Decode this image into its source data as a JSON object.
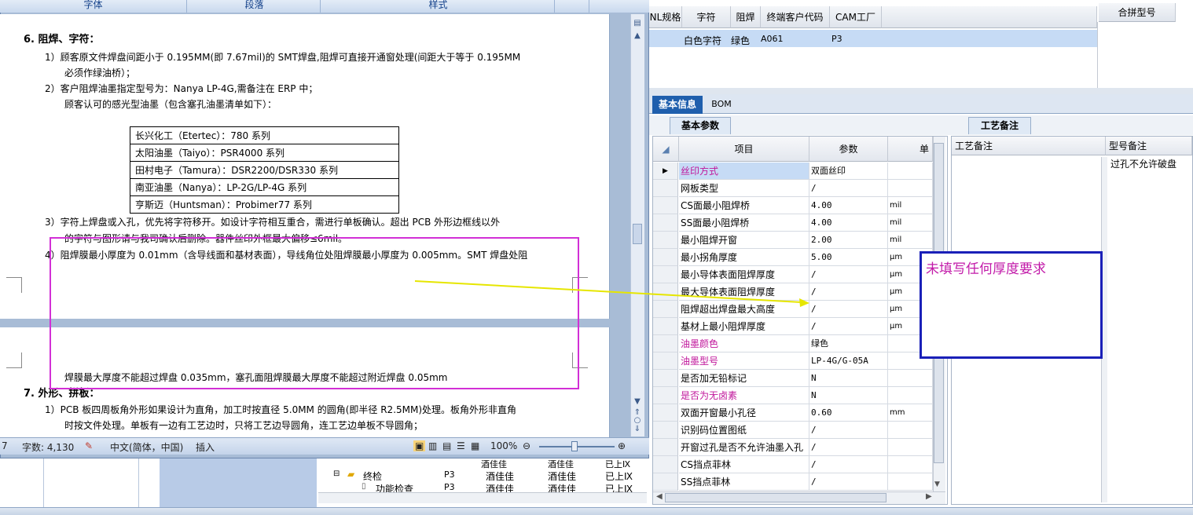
{
  "ribbon": {
    "groups": [
      "字体",
      "段落",
      "样式"
    ]
  },
  "doc": {
    "sec6_title": "6.   阻焊、字符：",
    "item1_line1": "1）顾客原文件焊盘间距小于 0.195MM(即 7.67mil)的 SMT焊盘,阻焊可直接开通窗处理(间距大于等于 0.195MM",
    "item1_line2": "必须作绿油桥）；",
    "item2_line1": "2）客户阻焊油墨指定型号为：Nanya LP-4G,需备注在 ERP 中；",
    "item2_line2": "顾客认可的感光型油墨（包含塞孔油墨清单如下）：",
    "ink_list": [
      "长兴化工（Etertec）：780 系列",
      "太阳油墨（Taiyo）：PSR4000 系列",
      "田村电子（Tamura）：DSR2200/DSR330 系列",
      "南亚油墨（Nanya）：LP-2G/LP-4G 系列",
      "亨斯迈（Huntsman）：Probimer77 系列"
    ],
    "item3_line1": "3）字符上焊盘或入孔，优先将字符移开。如设计字符相互重合，需进行单板确认。超出 PCB 外形边框线以外",
    "item3_line2": "的字符与图形请与我司确认后删除。器件丝印外框最大偏移≤6mil。",
    "item4_line1": "4）阻焊膜最小厚度为 0.01mm（含导线面和基材表面），导线角位处阻焊膜最小厚度为 0.005mm。SMT 焊盘处阻",
    "item4_line2": "焊膜最大厚度不能超过焊盘 0.035mm，塞孔面阻焊膜最大厚度不能超过附近焊盘 0.05mm",
    "sec7_title": "7.   外形、拼板：",
    "item7_1_line1": "1）PCB 板四周板角外形如果设计为直角，加工时按直径 5.0MM 的圆角(即半径 R2.5MM)处理。板角外形非直角",
    "item7_1_line2": "时按文件处理。单板有一边有工艺边时，只将工艺边导圆角，连工艺边单板不导圆角；"
  },
  "status_bar": {
    "page": "7",
    "word_count": "字数: 4,130",
    "language": "中文(简体，中国)",
    "mode": "插入",
    "zoom": "100%"
  },
  "right_top": {
    "headers": [
      "NL规格",
      "字符",
      "阻焊",
      "终端客户代码",
      "CAM工厂"
    ],
    "merge_header": "合拼型号",
    "row": [
      "",
      "白色字符",
      "绿色",
      "A061",
      "P3"
    ]
  },
  "tabs": {
    "basic": "基本信息",
    "bom": "BOM",
    "sub_basic": "基本参数",
    "sub_process": "工艺备注"
  },
  "grid": {
    "headers": [
      "项目",
      "参数",
      "单位"
    ],
    "rows": [
      {
        "item": "丝印方式",
        "value": "双面丝印",
        "unit": ""
      },
      {
        "item": "网板类型",
        "value": "/",
        "unit": ""
      },
      {
        "item": "CS面最小阻焊桥",
        "value": "4.00",
        "unit": "mil"
      },
      {
        "item": "SS面最小阻焊桥",
        "value": "4.00",
        "unit": "mil"
      },
      {
        "item": "最小阻焊开窗",
        "value": "2.00",
        "unit": "mil"
      },
      {
        "item": "最小拐角厚度",
        "value": "5.00",
        "unit": "μm"
      },
      {
        "item": "最小导体表面阻焊厚度",
        "value": "/",
        "unit": "μm"
      },
      {
        "item": "最大导体表面阻焊厚度",
        "value": "/",
        "unit": "μm"
      },
      {
        "item": "阻焊超出焊盘最大高度",
        "value": "/",
        "unit": "μm"
      },
      {
        "item": "基材上最小阻焊厚度",
        "value": "/",
        "unit": "μm"
      },
      {
        "item": "油墨颜色",
        "value": "绿色",
        "unit": ""
      },
      {
        "item": "油墨型号",
        "value": "LP-4G/G-05A",
        "unit": ""
      },
      {
        "item": "是否加无铅标记",
        "value": "N",
        "unit": ""
      },
      {
        "item": "是否为无卤素",
        "value": "N",
        "unit": ""
      },
      {
        "item": "双面开窗最小孔径",
        "value": "0.60",
        "unit": "mm"
      },
      {
        "item": "识别码位置图纸",
        "value": "/",
        "unit": ""
      },
      {
        "item": "开窗过孔是否不允许油墨入孔",
        "value": "/",
        "unit": ""
      },
      {
        "item": "CS挡点菲林",
        "value": "/",
        "unit": ""
      },
      {
        "item": "SS挡点菲林",
        "value": "/",
        "unit": ""
      }
    ]
  },
  "notes": {
    "col1": "工艺备注",
    "col2": "型号备注",
    "value": "过孔不允许破盘"
  },
  "annotation": {
    "text": "未填写任何厚度要求"
  },
  "tree": {
    "node1": "终检",
    "node1_code": "P3",
    "node1_a": "酒佳佳",
    "node1_b": "酒佳佳",
    "node1_c": "已上Ⅸ",
    "node_top_a": "酒佳佳",
    "node_top_b": "酒佳佳",
    "node_top_c": "已上Ⅸ",
    "node2": "功能检查",
    "node2_code": "P3",
    "node2_a": "酒佳佳",
    "node2_b": "酒佳佳",
    "node2_c": "已上Ⅸ"
  },
  "colors": {
    "highlight_magenta": "#c0169b",
    "annotation_box": "#d22fd6",
    "note_border": "#1a20b8",
    "selected_tab": "#1f5fad",
    "arrow": "#e6e600"
  }
}
